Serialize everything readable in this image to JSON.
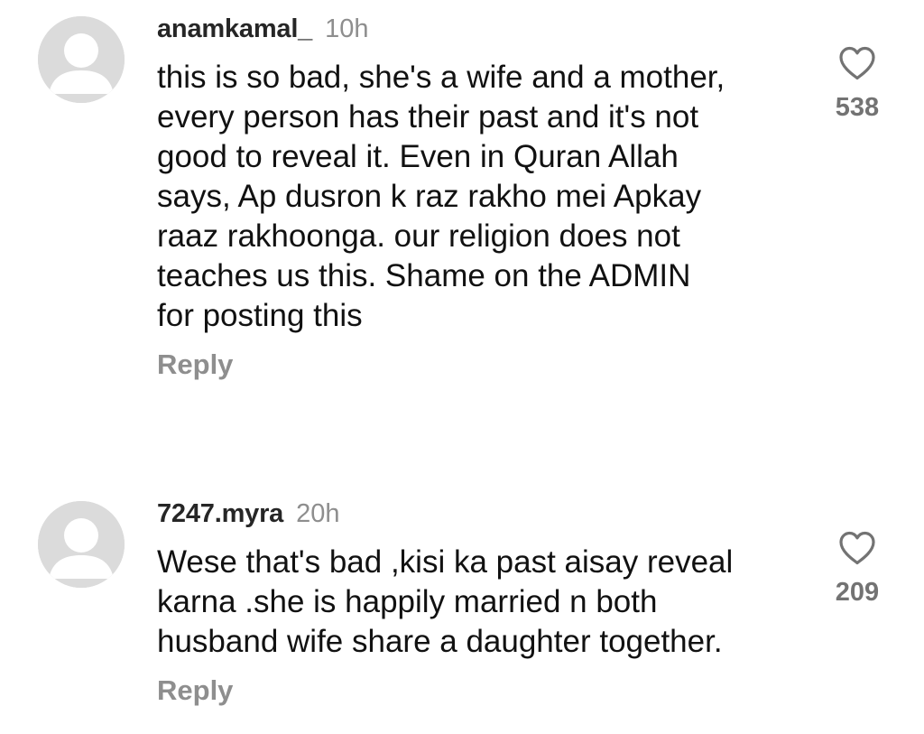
{
  "comments": [
    {
      "username": "anamkamal_",
      "time": "10h",
      "text": "this is so bad, she's a wife and a mother,\nevery person has their past and it's not\ngood to reveal it. Even in Quran Allah\nsays, Ap dusron k raz rakho mei Apkay\nraaz rakhoonga. our religion does not\nteaches us this. Shame on the ADMIN\nfor posting this",
      "reply_label": "Reply",
      "likes": "538",
      "avatar_icon": "default-avatar-icon",
      "like_icon": "heart-outline-icon"
    },
    {
      "username": "7247.myra",
      "time": "20h",
      "text": "Wese that's bad ,kisi ka past aisay reveal\nkarna .she is happily married n both\nhusband wife share a daughter together.",
      "reply_label": "Reply",
      "likes": "209",
      "avatar_icon": "default-avatar-icon",
      "like_icon": "heart-outline-icon"
    }
  ],
  "colors": {
    "username": "#262626",
    "secondary": "#8e8e8e",
    "like_count": "#737373",
    "avatar_bg": "#dbdbdb"
  }
}
